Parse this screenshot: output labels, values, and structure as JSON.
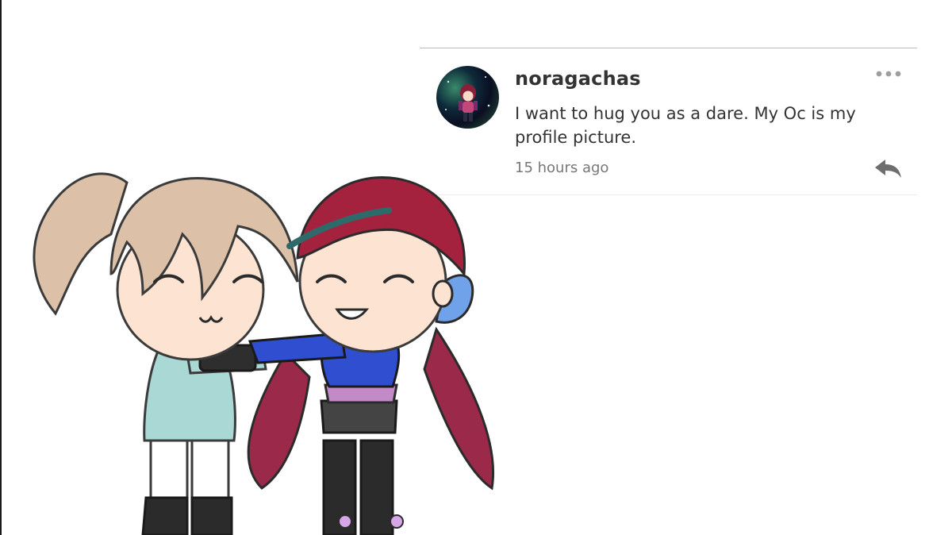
{
  "comment": {
    "username": "noragachas",
    "text": "I want to hug you as a dare. My Oc is my profile picture.",
    "timestamp": "15 hours ago"
  },
  "icons": {
    "more": "more-horizontal-icon",
    "reply": "reply-icon"
  },
  "colors": {
    "text_primary": "#333333",
    "text_secondary": "#777777",
    "icon_gray": "#9e9e9e",
    "divider": "#bdbdbd"
  }
}
